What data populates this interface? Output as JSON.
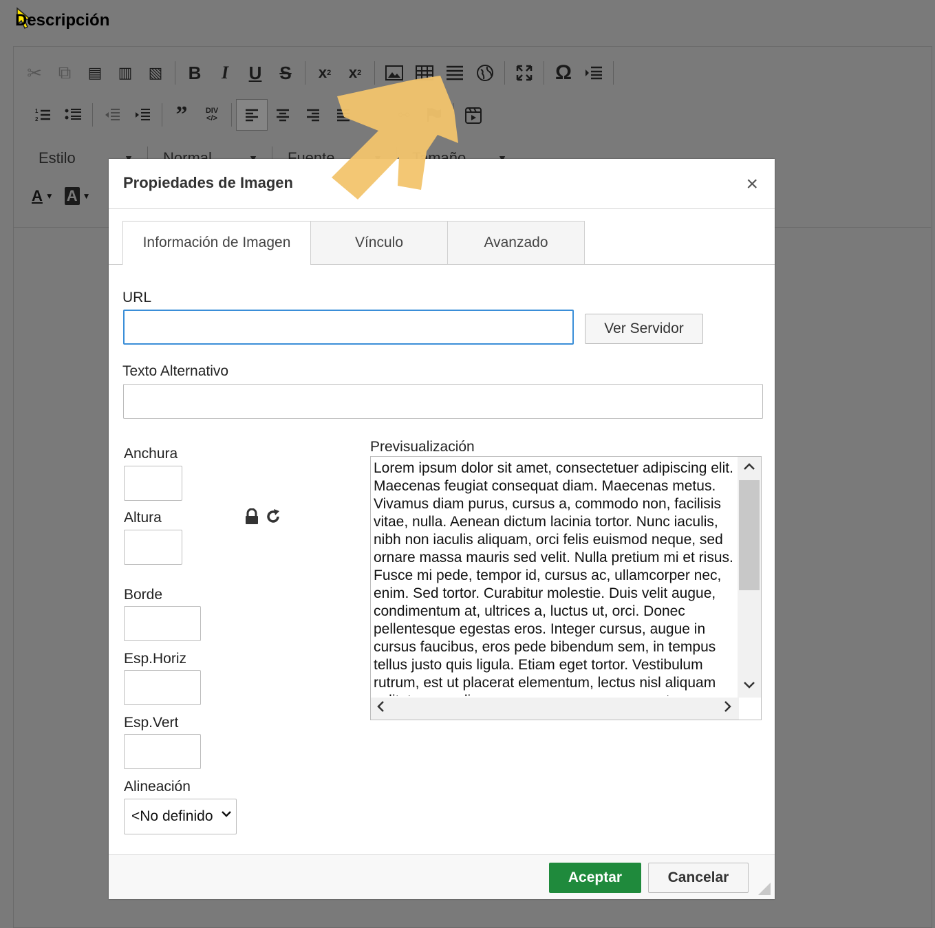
{
  "editor": {
    "title": "Descripción",
    "toolbar_row1": [
      {
        "icon": "cut-icon",
        "glyph": "✂"
      },
      {
        "icon": "copy-icon",
        "glyph": "⧉"
      },
      {
        "icon": "paste-icon",
        "glyph": "📋"
      },
      {
        "icon": "paste-text-icon",
        "glyph": "📋"
      },
      {
        "icon": "paste-word-icon",
        "glyph": "📋"
      },
      {
        "icon": "bold-icon",
        "glyph": "B"
      },
      {
        "icon": "italic-icon",
        "glyph": "I"
      },
      {
        "icon": "underline-icon",
        "glyph": "U"
      },
      {
        "icon": "strike-icon",
        "glyph": "S"
      },
      {
        "icon": "subscript-icon",
        "glyph": "x₂"
      },
      {
        "icon": "superscript-icon",
        "glyph": "x²"
      },
      {
        "icon": "image-icon",
        "glyph": "🖼"
      },
      {
        "icon": "table-icon",
        "glyph": "▦"
      },
      {
        "icon": "horizontal-rule-icon",
        "glyph": "☰"
      },
      {
        "icon": "globe-icon",
        "glyph": "🌐"
      },
      {
        "icon": "maximize-icon",
        "glyph": "⛶"
      },
      {
        "icon": "special-char-icon",
        "glyph": "Ω"
      },
      {
        "icon": "indent-list-icon",
        "glyph": "⇥"
      }
    ],
    "toolbar_row2": [
      {
        "icon": "numbered-list-icon",
        "glyph": "≔"
      },
      {
        "icon": "bulleted-list-icon",
        "glyph": "☷"
      },
      {
        "icon": "outdent-icon",
        "glyph": "⇤"
      },
      {
        "icon": "indent-icon",
        "glyph": "⇥"
      },
      {
        "icon": "blockquote-icon",
        "glyph": "❞"
      },
      {
        "icon": "div-icon",
        "glyph": "DIV"
      },
      {
        "icon": "align-left-icon",
        "glyph": "≡"
      },
      {
        "icon": "align-center-icon",
        "glyph": "≡"
      },
      {
        "icon": "align-right-icon",
        "glyph": "≡"
      },
      {
        "icon": "justify-icon",
        "glyph": "≡"
      },
      {
        "icon": "link-icon",
        "glyph": "🔗"
      },
      {
        "icon": "unlink-icon",
        "glyph": "⛓"
      },
      {
        "icon": "anchor-flag-icon",
        "glyph": "⚑"
      },
      {
        "icon": "media-embed-icon",
        "glyph": "▶"
      }
    ],
    "combos": [
      "Estilo",
      "Normal",
      "Fuente",
      "Tamaño"
    ],
    "text_color_label": "A",
    "bg_color_label": "A"
  },
  "dialog": {
    "title": "Propiedades de Imagen",
    "close": "×",
    "tabs": [
      "Información de Imagen",
      "Vínculo",
      "Avanzado"
    ],
    "url_label": "URL",
    "url_value": "",
    "server_button": "Ver Servidor",
    "alt_label": "Texto Alternativo",
    "alt_value": "",
    "width_label": "Anchura",
    "height_label": "Altura",
    "border_label": "Borde",
    "hspace_label": "Esp.Horiz",
    "vspace_label": "Esp.Vert",
    "align_label": "Alineación",
    "align_value": "<No definido>",
    "preview_label": "Previsualización",
    "preview_text": "Lorem ipsum dolor sit amet, consectetuer adipiscing elit. Maecenas feugiat consequat diam. Maecenas metus. Vivamus diam purus, cursus a, commodo non, facilisis vitae, nulla. Aenean dictum lacinia tortor. Nunc iaculis, nibh non iaculis aliquam, orci felis euismod neque, sed ornare massa mauris sed velit. Nulla pretium mi et risus. Fusce mi pede, tempor id, cursus ac, ullamcorper nec, enim. Sed tortor. Curabitur molestie. Duis velit augue, condimentum at, ultrices a, luctus ut, orci. Donec pellentesque egestas eros. Integer cursus, augue in cursus faucibus, eros pede bibendum sem, in tempus tellus justo quis ligula. Etiam eget tortor. Vestibulum rutrum, est ut placerat elementum, lectus nisl aliquam velit, tempor aliquam eros nunc nonummy metus.",
    "ok_button": "Aceptar",
    "cancel_button": "Cancelar"
  },
  "colors": {
    "accent_focus": "#3a8ed8",
    "ok_green": "#1f8a3c",
    "overlay_gray": "#7a7a7a",
    "annotation_arrow": "#f2c46d"
  }
}
